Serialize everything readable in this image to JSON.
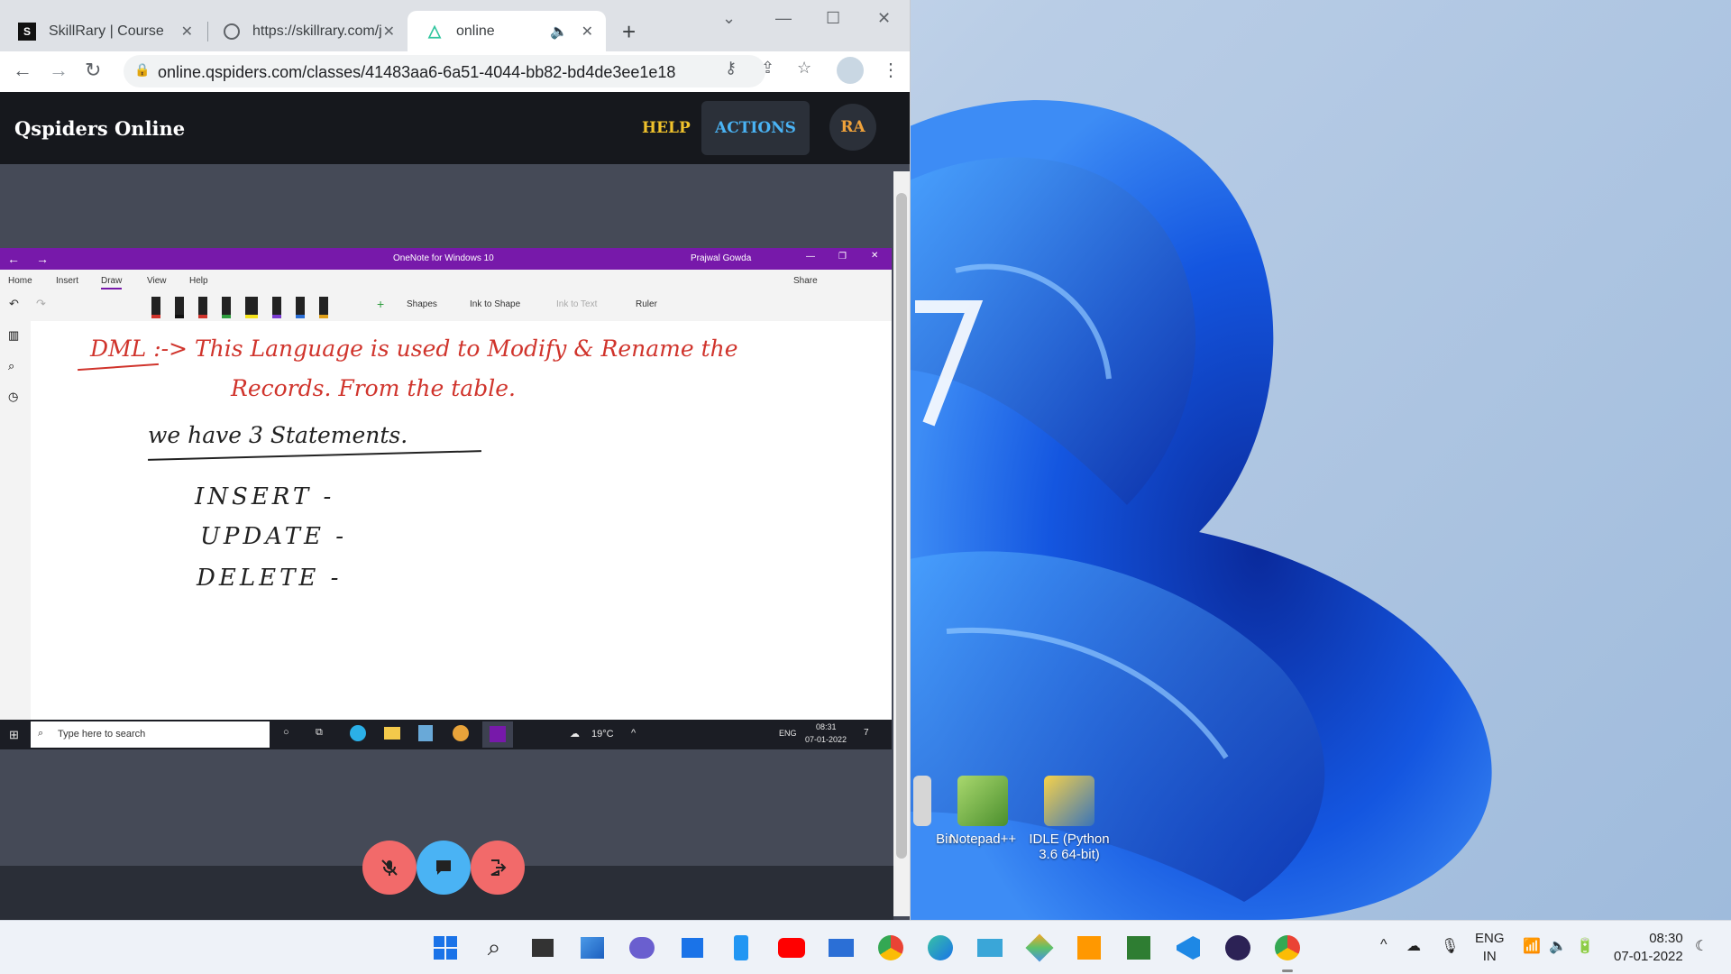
{
  "browser": {
    "tabs": [
      {
        "title": "SkillRary | Course",
        "favicon": "skillrary-icon",
        "active": false
      },
      {
        "title": "https://skillrary.com/j",
        "favicon": "globe-icon",
        "active": false
      },
      {
        "title": "online",
        "favicon": "qspiders-icon",
        "active": true,
        "audio": true
      }
    ],
    "url": "online.qspiders.com/classes/41483aa6-6a51-4044-bb82-bd4de3ee1e18"
  },
  "app": {
    "brand": "Qspiders Online",
    "help_label": "HELP",
    "actions_label": "ACTIONS",
    "avatar_initials": "RA"
  },
  "onenote": {
    "window_title": "OneNote for Windows 10",
    "user": "Prajwal Gowda",
    "ribbon_tabs": [
      "Home",
      "Insert",
      "Draw",
      "View",
      "Help"
    ],
    "active_tab": "Draw",
    "share_label": "Share",
    "tools": {
      "shapes": "Shapes",
      "ink_to_shape": "Ink to Shape",
      "ink_to_text": "Ink to Text",
      "ruler": "Ruler"
    },
    "notes": {
      "line1": "DML :-> This Language is used to Modify & Rename the",
      "line2": "Records. From the table.",
      "line3": "we have 3 Statements.",
      "items": [
        "INSERT -",
        "UPDATE -",
        "DELETE -"
      ]
    },
    "taskbar": {
      "search_placeholder": "Type here to search",
      "weather": "19°C",
      "lang": "ENG",
      "time": "08:31",
      "date": "07-01-2022",
      "notif_count": "7"
    }
  },
  "desktop_icons": [
    {
      "label": "Bin"
    },
    {
      "label": "Notepad++"
    },
    {
      "label": "IDLE (Python 3.6 64-bit)"
    }
  ],
  "taskbar": {
    "lang_top": "ENG",
    "lang_bottom": "IN",
    "time": "08:30",
    "date": "07-01-2022"
  },
  "colors": {
    "onenote_purple": "#7719aa",
    "ink_red": "#d0342c",
    "help_yellow": "#f0c22c",
    "actions_blue": "#4ab3f4",
    "meeting_red": "#f26a6a",
    "meeting_blue": "#4ab3f4"
  }
}
